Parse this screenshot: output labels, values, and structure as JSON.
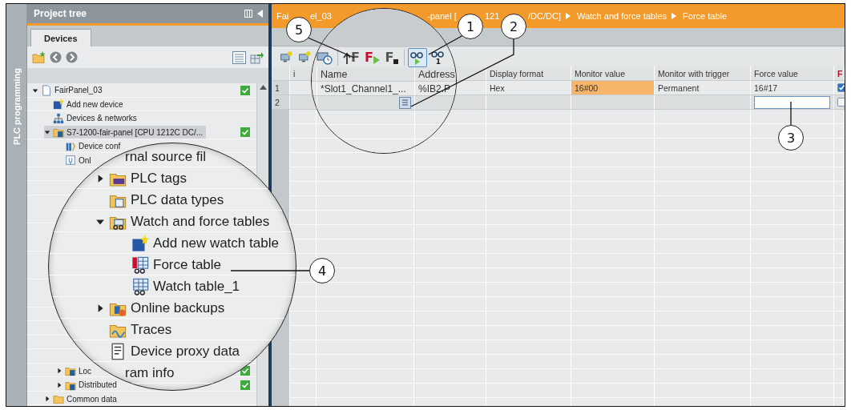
{
  "side_tab": {
    "label": "PLC programming"
  },
  "project_tree": {
    "title": "Project tree",
    "tabs": [
      {
        "label": "Devices",
        "selected": true
      }
    ],
    "items": [
      {
        "label": "FairPanel_03",
        "kind": "project",
        "expanded": true,
        "selected": false,
        "status_ok": true,
        "children": [
          {
            "label": "Add new device",
            "kind": "add",
            "selected": false
          },
          {
            "label": "Devices & networks",
            "kind": "network",
            "selected": false
          },
          {
            "label": "S7-1200-fair-panel [CPU 1212C DC/...",
            "kind": "cpu",
            "expanded": true,
            "selected": true,
            "status_ok": true,
            "children": [
              {
                "label": "Device conf",
                "kind": "config",
                "selected": false
              },
              {
                "label": "Onl",
                "kind": "online",
                "selected": false
              },
              {
                "label": "Loc",
                "kind": "device-folder",
                "expanded": false,
                "selected": false,
                "status_ok": true
              },
              {
                "label": "Distributed",
                "kind": "device-folder",
                "expanded": false,
                "selected": false,
                "status_ok": true
              }
            ]
          },
          {
            "label": "Common data",
            "kind": "folder",
            "expanded": false,
            "selected": false
          }
        ]
      }
    ],
    "magnified_items": [
      {
        "label": "rnal source fil",
        "kind": "fragment",
        "selected": false
      },
      {
        "label": "PLC tags",
        "kind": "tags",
        "expanded": false,
        "selected": false
      },
      {
        "label": "PLC data types",
        "kind": "types",
        "selected": false
      },
      {
        "label": "Watch and force tables",
        "kind": "watch-folder",
        "expanded": true,
        "selected": false,
        "children": [
          {
            "label": "Add new watch table",
            "kind": "add",
            "selected": false
          },
          {
            "label": "Force table",
            "kind": "force-table",
            "selected": false
          },
          {
            "label": "Watch table_1",
            "kind": "watch-table",
            "selected": false
          }
        ]
      },
      {
        "label": "Online backups",
        "kind": "backup",
        "expanded": false,
        "selected": false
      },
      {
        "label": "Traces",
        "kind": "trace",
        "selected": false
      },
      {
        "label": "Device proxy data",
        "kind": "proxy",
        "selected": false
      },
      {
        "label": "ram info",
        "kind": "fragment",
        "selected": false
      }
    ]
  },
  "breadcrumb": [
    "Fai",
    "el_03",
    "-panel [",
    "121",
    "/DC/DC]",
    "Watch and force tables",
    "Force table"
  ],
  "toolbar": [
    {
      "kind": "add-monitor",
      "selected": false
    },
    {
      "kind": "add-monitor",
      "selected": false
    },
    {
      "kind": "monitor-timer",
      "selected": false
    },
    {
      "kind": "force-load",
      "label": "F",
      "selected": false
    },
    {
      "kind": "force",
      "label": "F",
      "selected": false
    },
    {
      "kind": "stop-force",
      "label": "F",
      "selected": false
    },
    {
      "kind": "monitor-all",
      "selected": true
    },
    {
      "kind": "monitor-once",
      "label": "1",
      "selected": false
    }
  ],
  "table": {
    "columns": [
      {
        "label": "i",
        "kind": "info"
      },
      {
        "label": "Name"
      },
      {
        "label": "Address"
      },
      {
        "label": "Display format"
      },
      {
        "label": "Monitor value"
      },
      {
        "label": "Monitor with trigger"
      },
      {
        "label": "Force value"
      },
      {
        "label": "F",
        "kind": "force"
      }
    ],
    "rows": [
      {
        "number": "1",
        "name": "*Slot1_Channel1_...",
        "address": "%IB2.P",
        "display_format": "Hex",
        "monitor_value": "16#00",
        "monitor_highlighted": true,
        "monitor_with_trigger": "Permanent",
        "force_value": "16#17",
        "editing": false,
        "force_checked": true
      },
      {
        "number": "2",
        "editing": true,
        "picker": true,
        "force_checked": false
      }
    ]
  },
  "callouts": [
    {
      "number": "5"
    },
    {
      "number": "1"
    },
    {
      "number": "2"
    },
    {
      "number": "3"
    },
    {
      "number": "4"
    }
  ]
}
